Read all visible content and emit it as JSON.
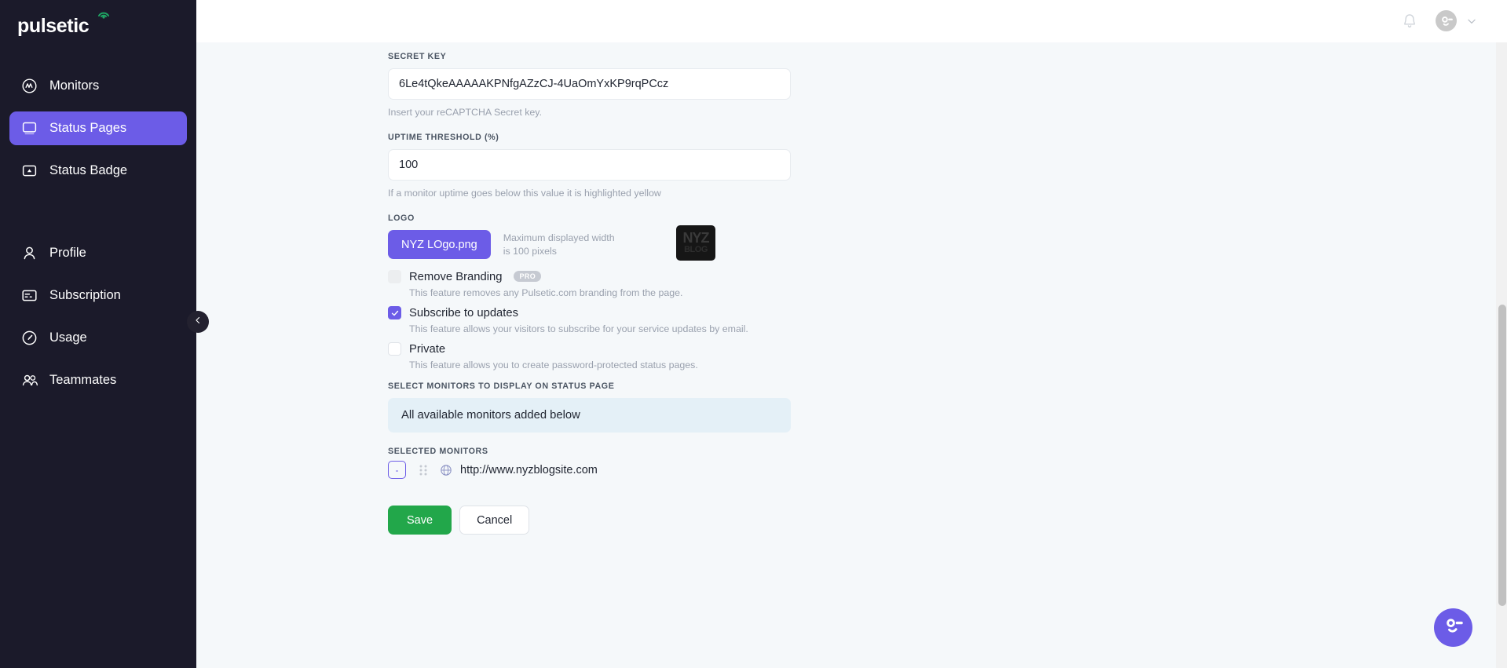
{
  "brand": {
    "name": "pulsetic"
  },
  "sidebar": {
    "groups": [
      {
        "items": [
          {
            "label": "Monitors",
            "icon": "monitor-wave-icon",
            "active": false
          },
          {
            "label": "Status Pages",
            "icon": "status-page-icon",
            "active": true
          },
          {
            "label": "Status Badge",
            "icon": "status-badge-icon",
            "active": false
          }
        ]
      },
      {
        "items": [
          {
            "label": "Profile",
            "icon": "user-icon",
            "active": false
          },
          {
            "label": "Subscription",
            "icon": "credit-card-icon",
            "active": false
          },
          {
            "label": "Usage",
            "icon": "gauge-icon",
            "active": false
          },
          {
            "label": "Teammates",
            "icon": "users-icon",
            "active": false
          }
        ]
      }
    ],
    "collapse_icon": "chevron-left-icon"
  },
  "topbar": {
    "notifications_icon": "bell-icon",
    "avatar_icon": "user-avatar-icon",
    "dropdown_icon": "chevron-down-icon"
  },
  "form": {
    "secret_key": {
      "label": "SECRET KEY",
      "value": "6Le4tQkeAAAAAKPNfgAZzCJ-4UaOmYxKP9rqPCcz",
      "placeholder": "Secret key",
      "help": "Insert your reCAPTCHA Secret key."
    },
    "uptime_threshold": {
      "label": "UPTIME THRESHOLD (%)",
      "value": "100",
      "placeholder": "100",
      "help": "If a monitor uptime goes below this value it is highlighted yellow"
    },
    "logo": {
      "label": "LOGO",
      "button_label": "NYZ LOgo.png",
      "note": "Maximum displayed width is 100 pixels",
      "preview_line1": "NYZ",
      "preview_line2": "BLOG"
    },
    "checkboxes": [
      {
        "label": "Remove Branding",
        "badge": "PRO",
        "checked": false,
        "disabled": true,
        "description": "This feature removes any Pulsetic.com branding from the page."
      },
      {
        "label": "Subscribe to updates",
        "badge": "",
        "checked": true,
        "disabled": false,
        "description": "This feature allows your visitors to subscribe for your service updates by email."
      },
      {
        "label": "Private",
        "badge": "",
        "checked": false,
        "disabled": false,
        "description": "This feature allows you to create password-protected status pages."
      }
    ],
    "select_monitors": {
      "label": "SELECT MONITORS TO DISPLAY ON STATUS PAGE",
      "banner_text": "All available monitors added below"
    },
    "selected_monitors": {
      "label": "SELECTED MONITORS",
      "rows": [
        {
          "remove_label": "-",
          "drag_icon": "drag-handle-icon",
          "site_icon": "globe-icon",
          "url": "http://www.nyzblogsite.com"
        }
      ]
    },
    "actions": {
      "save_label": "Save",
      "cancel_label": "Cancel"
    }
  },
  "chat": {
    "icon": "chat-face-icon"
  },
  "colors": {
    "sidebar_bg": "#1b1a2a",
    "accent": "#6c5ce7",
    "save_green": "#22a74a",
    "banner_blue": "#e4f0f7",
    "page_bg": "#f5f8fa"
  }
}
